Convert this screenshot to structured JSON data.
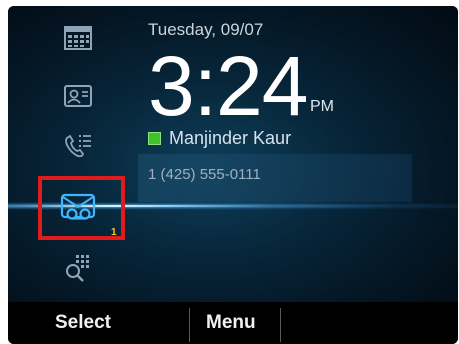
{
  "header": {
    "date": "Tuesday, 09/07",
    "time": "3:24",
    "ampm": "PM"
  },
  "user": {
    "name": "Manjinder Kaur",
    "presence_color": "#3ec32a"
  },
  "line": {
    "number": "1 (425) 555-0111"
  },
  "sidebar": {
    "items": [
      {
        "icon": "calendar-icon"
      },
      {
        "icon": "contacts-icon"
      },
      {
        "icon": "call-history-icon"
      },
      {
        "icon": "voicemail-icon",
        "badge": "1"
      },
      {
        "icon": "dialpad-search-icon"
      }
    ]
  },
  "softkeys": {
    "left": "Select",
    "middle": "Menu"
  },
  "colors": {
    "highlight_border": "#e01b1b",
    "badge": "#f2c818",
    "icon": "#8fa4b6",
    "voicemail_icon": "#3fb4ff"
  }
}
